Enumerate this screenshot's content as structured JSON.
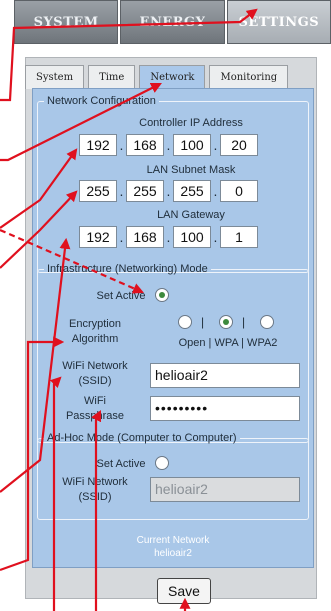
{
  "top_menu": [
    {
      "label": "SYSTEM",
      "active": false
    },
    {
      "label": "ENERGY",
      "active": false
    },
    {
      "label": "SETTINGS",
      "active": true
    }
  ],
  "tabs": [
    {
      "label": "System",
      "active": false
    },
    {
      "label": "Time",
      "active": false
    },
    {
      "label": "Network",
      "active": true
    },
    {
      "label": "Monitoring",
      "active": false
    }
  ],
  "network_config": {
    "legend": "Network Configuration",
    "controller_ip": {
      "label": "Controller IP Address",
      "octets": [
        "192",
        "168",
        "100",
        "20"
      ]
    },
    "subnet": {
      "label": "LAN Subnet Mask",
      "octets": [
        "255",
        "255",
        "255",
        "0"
      ]
    },
    "gateway": {
      "label": "LAN Gateway",
      "octets": [
        "192",
        "168",
        "100",
        "1"
      ]
    }
  },
  "infrastructure": {
    "legend": "Infrastructure (Networking) Mode",
    "set_active_label": "Set Active",
    "set_active": true,
    "encryption_label_line1": "Encryption",
    "encryption_label_line2": "Algorithm",
    "encryption_options": "Open | WPA | WPA2",
    "encryption_selected": "WPA",
    "separator": "|",
    "ssid_label_line1": "WiFi Network",
    "ssid_label_line2": "(SSID)",
    "ssid_value": "helioair2",
    "pass_label_line1": "WiFi",
    "pass_label_line2": "Passphrase",
    "pass_value": "•••••••••"
  },
  "adhoc": {
    "legend": "Ad-Hoc Mode (Computer to Computer)",
    "set_active_label": "Set Active",
    "set_active": false,
    "ssid_label_line1": "WiFi Network",
    "ssid_label_line2": "(SSID)",
    "ssid_value": "helioair2"
  },
  "current_network": {
    "label": "Current Network",
    "value": "helioair2"
  },
  "save_label": "Save",
  "colors": {
    "panel_blue": "#a9c7e8",
    "annotation_arrow": "#e0101e",
    "radio_selected": "#3d8a3d"
  }
}
